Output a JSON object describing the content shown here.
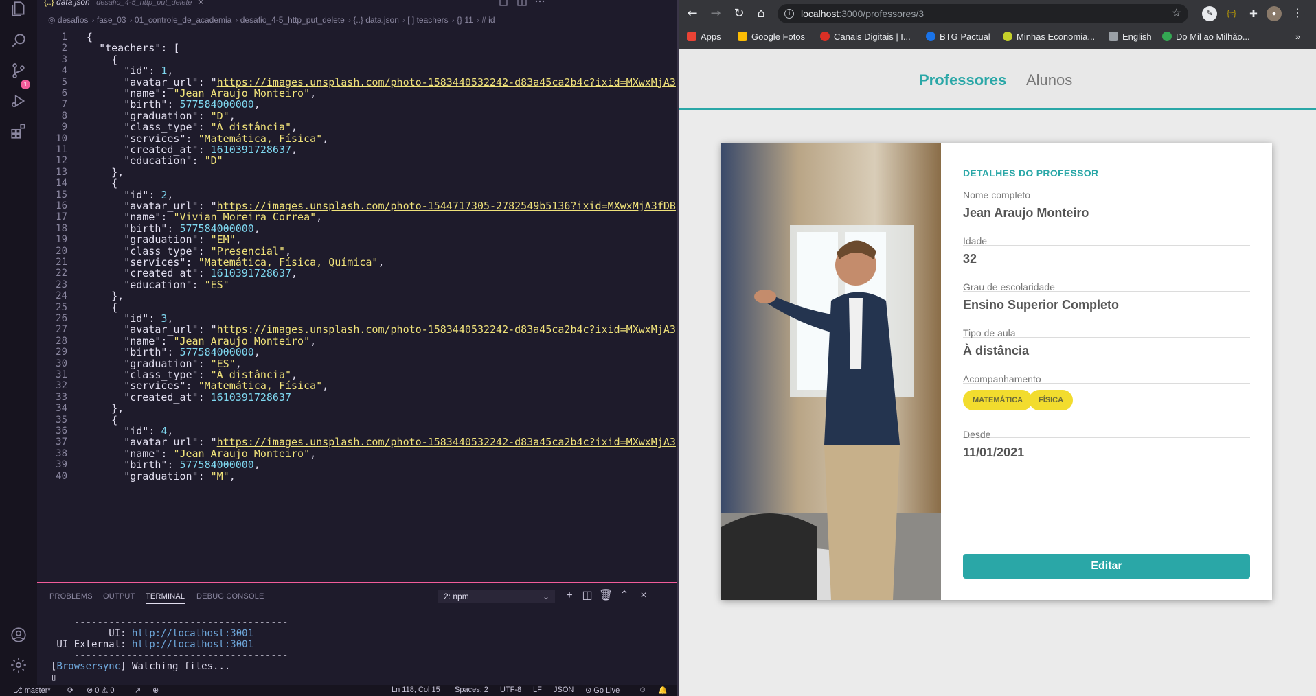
{
  "vscode": {
    "tab": {
      "filename": "data.json",
      "path": "desafio_4-5_http_put_delete",
      "close": "×"
    },
    "breadcrumb": [
      "desafios",
      "fase_03",
      "01_controle_de_academia",
      "desafio_4-5_http_put_delete",
      "{..} data.json",
      "[ ] teachers",
      "{} 11",
      "# id"
    ],
    "scm_badge": "1",
    "icons": [
      "files-icon",
      "search-icon",
      "source-control-icon",
      "run-debug-icon",
      "extensions-icon",
      "account-icon",
      "settings-gear-icon"
    ],
    "editor": {
      "lines": [
        {
          "n": "1",
          "code": "{"
        },
        {
          "n": "2",
          "code": "  \"teachers\": ["
        },
        {
          "n": "3",
          "code": "    {"
        },
        {
          "n": "4",
          "code": "      \"id\": 1,"
        },
        {
          "n": "5",
          "code": "      \"avatar_url\": \"https://images.unsplash.com/photo-1583440532242-d83a45ca2b4c?ixid=MXwxMjA3"
        },
        {
          "n": "6",
          "code": "      \"name\": \"Jean Araujo Monteiro\","
        },
        {
          "n": "7",
          "code": "      \"birth\": 577584000000,"
        },
        {
          "n": "8",
          "code": "      \"graduation\": \"D\","
        },
        {
          "n": "9",
          "code": "      \"class_type\": \"À distância\","
        },
        {
          "n": "10",
          "code": "      \"services\": \"Matemática, Física\","
        },
        {
          "n": "11",
          "code": "      \"created_at\": 1610391728637,"
        },
        {
          "n": "12",
          "code": "      \"education\": \"D\""
        },
        {
          "n": "13",
          "code": "    },"
        },
        {
          "n": "14",
          "code": "    {"
        },
        {
          "n": "15",
          "code": "      \"id\": 2,"
        },
        {
          "n": "16",
          "code": "      \"avatar_url\": \"https://images.unsplash.com/photo-1544717305-2782549b5136?ixid=MXwxMjA3fDB"
        },
        {
          "n": "17",
          "code": "      \"name\": \"Vivian Moreira Correa\","
        },
        {
          "n": "18",
          "code": "      \"birth\": 577584000000,"
        },
        {
          "n": "19",
          "code": "      \"graduation\": \"EM\","
        },
        {
          "n": "20",
          "code": "      \"class_type\": \"Presencial\","
        },
        {
          "n": "21",
          "code": "      \"services\": \"Matemática, Física, Química\","
        },
        {
          "n": "22",
          "code": "      \"created_at\": 1610391728637,"
        },
        {
          "n": "23",
          "code": "      \"education\": \"ES\""
        },
        {
          "n": "24",
          "code": "    },"
        },
        {
          "n": "25",
          "code": "    {"
        },
        {
          "n": "26",
          "code": "      \"id\": 3,"
        },
        {
          "n": "27",
          "code": "      \"avatar_url\": \"https://images.unsplash.com/photo-1583440532242-d83a45ca2b4c?ixid=MXwxMjA3"
        },
        {
          "n": "28",
          "code": "      \"name\": \"Jean Araujo Monteiro\","
        },
        {
          "n": "29",
          "code": "      \"birth\": 577584000000,"
        },
        {
          "n": "30",
          "code": "      \"graduation\": \"ES\","
        },
        {
          "n": "31",
          "code": "      \"class_type\": \"À distância\","
        },
        {
          "n": "32",
          "code": "      \"services\": \"Matemática, Física\","
        },
        {
          "n": "33",
          "code": "      \"created_at\": 1610391728637"
        },
        {
          "n": "34",
          "code": "    },"
        },
        {
          "n": "35",
          "code": "    {"
        },
        {
          "n": "36",
          "code": "      \"id\": 4,"
        },
        {
          "n": "37",
          "code": "      \"avatar_url\": \"https://images.unsplash.com/photo-1583440532242-d83a45ca2b4c?ixid=MXwxMjA3"
        },
        {
          "n": "38",
          "code": "      \"name\": \"Jean Araujo Monteiro\","
        },
        {
          "n": "39",
          "code": "      \"birth\": 577584000000,"
        },
        {
          "n": "40",
          "code": "      \"graduation\": \"M\","
        }
      ]
    },
    "panel": {
      "tabs": [
        "PROBLEMS",
        "OUTPUT",
        "TERMINAL",
        "DEBUG CONSOLE"
      ],
      "active_tab": "TERMINAL",
      "terminal_select": "2: npm",
      "terminal_lines": [
        {
          "pre": "    ",
          "text": "-------------------------------------"
        },
        {
          "label": "          UI: ",
          "url": "http://localhost:3001"
        },
        {
          "label": " UI External: ",
          "url": "http://localhost:3001"
        },
        {
          "pre": "    ",
          "text": "-------------------------------------"
        },
        {
          "tag": "Browsersync",
          "text": " Watching files..."
        }
      ]
    },
    "status": {
      "branch": "master*",
      "problems": "⊗ 0 ⚠ 0",
      "position": "Ln 118, Col 15",
      "spaces": "Spaces: 2",
      "encoding": "UTF-8",
      "eol": "LF",
      "language": "JSON",
      "golive": "Go Live"
    }
  },
  "browser": {
    "url_host": "localhost",
    "url_path": ":3000/professores/3",
    "bookmarks": [
      {
        "label": "Apps",
        "color": "#ea4335"
      },
      {
        "label": "Google Fotos",
        "color": "#fbbc04"
      },
      {
        "label": "Canais Digitais | I...",
        "color": "#d93025"
      },
      {
        "label": "BTG Pactual",
        "color": "#1a73e8"
      },
      {
        "label": "Minhas Economia...",
        "color": "#c5d12a"
      },
      {
        "label": "English",
        "color": "#9aa0a6"
      },
      {
        "label": "Do Mil ao Milhão...",
        "color": "#34a853"
      }
    ],
    "nav": {
      "professores": "Professores",
      "alunos": "Alunos"
    },
    "card": {
      "title": "DETALHES DO PROFESSOR",
      "fields": [
        {
          "label": "Nome completo",
          "value": "Jean Araujo Monteiro"
        },
        {
          "label": "Idade",
          "value": "32"
        },
        {
          "label": "Grau de escolaridade",
          "value": "Ensino Superior Completo"
        },
        {
          "label": "Tipo de aula",
          "value": "À distância"
        },
        {
          "label": "Acompanhamento",
          "tags": [
            "MATEMÁTICA",
            "FÍSICA"
          ]
        },
        {
          "label": "Desde",
          "value": "11/01/2021"
        }
      ],
      "edit_label": "Editar"
    }
  }
}
